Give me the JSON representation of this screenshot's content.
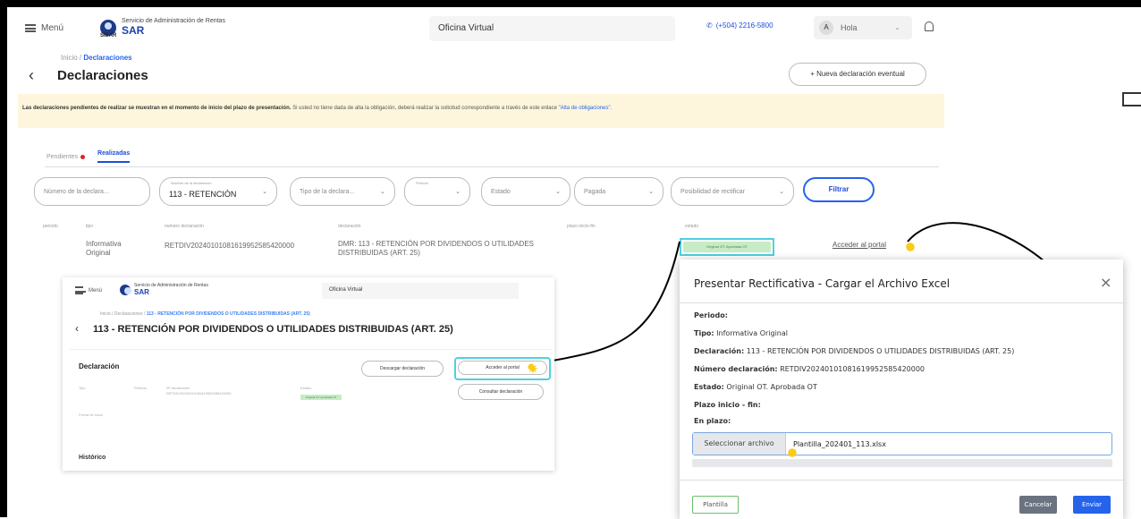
{
  "header": {
    "menu_label": "Menú",
    "org_name": "Servicio de Administración de Rentas",
    "brand": "SAR",
    "brand_sub": "SISAR",
    "office_label": "Oficina Virtual",
    "phone": "(+504) 2216-5800",
    "user_initial": "A",
    "greeting": "Hola"
  },
  "breadcrumb": {
    "root": "Inicio /",
    "current": "Declaraciones"
  },
  "page": {
    "title": "Declaraciones",
    "new_button": "+ Nueva declaración eventual"
  },
  "notice": {
    "bold": "Las declaraciones pendientes de realizar se muestran en el momento de inicio del plazo de presentación.",
    "text": "Si usted no tiene dada de alta la obligación, deberá realizar la solicitud correspondiente a través de este enlace",
    "link": "\"Alta de obligaciones\"."
  },
  "tabs": {
    "pending": "Pendientes",
    "done": "Realizadas"
  },
  "filters": {
    "numero": "Número de la declara...",
    "nombre_label": "Nombre de la declaración",
    "nombre_value": "113 - RETENCIÓN",
    "tipo": "Tipo de la declara...",
    "periodo": "Periodo",
    "estado": "Estado",
    "pagada": "Pagada",
    "rectificar": "Posibilidad de rectificar",
    "filtrar": "Filtrar"
  },
  "table": {
    "headers": [
      "periodo",
      "tipo",
      "numero declaración",
      "declaración",
      "plazo inicio-fin",
      "estado"
    ],
    "row": {
      "tipo": "Informativa Original",
      "numero": "RETDIV20240101081619952585420000",
      "declaracion": "DMR: 113 - RETENCIÓN POR DIVIDENDOS O UTILIDADES DISTRIBUIDAS (ART. 25)",
      "estado": "Original OT. Aprobada OT",
      "accion": "Acceder al portal"
    }
  },
  "inset": {
    "menu_label": "Menú",
    "org_name": "Servicio de Administración de Rentas",
    "brand": "SAR",
    "office_label": "Oficina Virtual",
    "crumb_root": "Inicio / Declaraciones /",
    "crumb_current": "113 - RETENCIÓN POR DIVIDENDOS O UTILIDADES DISTRIBUIDAS (ART. 25)",
    "title": "113 - RETENCIÓN POR DIVIDENDOS O UTILIDADES DISTRIBUIDAS (ART. 25)",
    "card_title": "Declaración",
    "download_button": "Descargar declaración",
    "portal_button": "Acceder al portal",
    "consult_button": "Consultar declaración",
    "col1": "Tipo",
    "col2": "Periodo",
    "col3": "Nº declaración",
    "col4": "Estado",
    "decl_no": "RETDIV20240101081619952585420000",
    "status": "Original OT. Aprobada OT",
    "small_note": "Fecha de inicio",
    "historico": "Histórico"
  },
  "dialog": {
    "title": "Presentar Rectificativa - Cargar el Archivo Excel",
    "periodo_label": "Periodo:",
    "tipo_label": "Tipo:",
    "tipo_value": "Informativa Original",
    "declaracion_label": "Declaración:",
    "declaracion_value": "113 - RETENCIÓN POR DIVIDENDOS O UTILIDADES DISTRIBUIDAS (ART. 25)",
    "numero_label": "Número declaración:",
    "numero_value": "RETDIV20240101081619952585420000",
    "estado_label": "Estado:",
    "estado_value": "Original OT. Aprobada OT",
    "plazo_label": "Plazo inicio - fin:",
    "enplazo_label": "En plazo:",
    "file_button": "Seleccionar archivo",
    "file_name": "Plantilla_202401_113.xlsx",
    "plantilla_button": "Plantilla",
    "cancel_button": "Cancelar",
    "send_button": "Enviar"
  },
  "colors": {
    "accent": "#2563eb",
    "highlight": "#4dd0e1",
    "notice_bg": "#fdf6dc",
    "status_bg": "#c7ecc5"
  }
}
